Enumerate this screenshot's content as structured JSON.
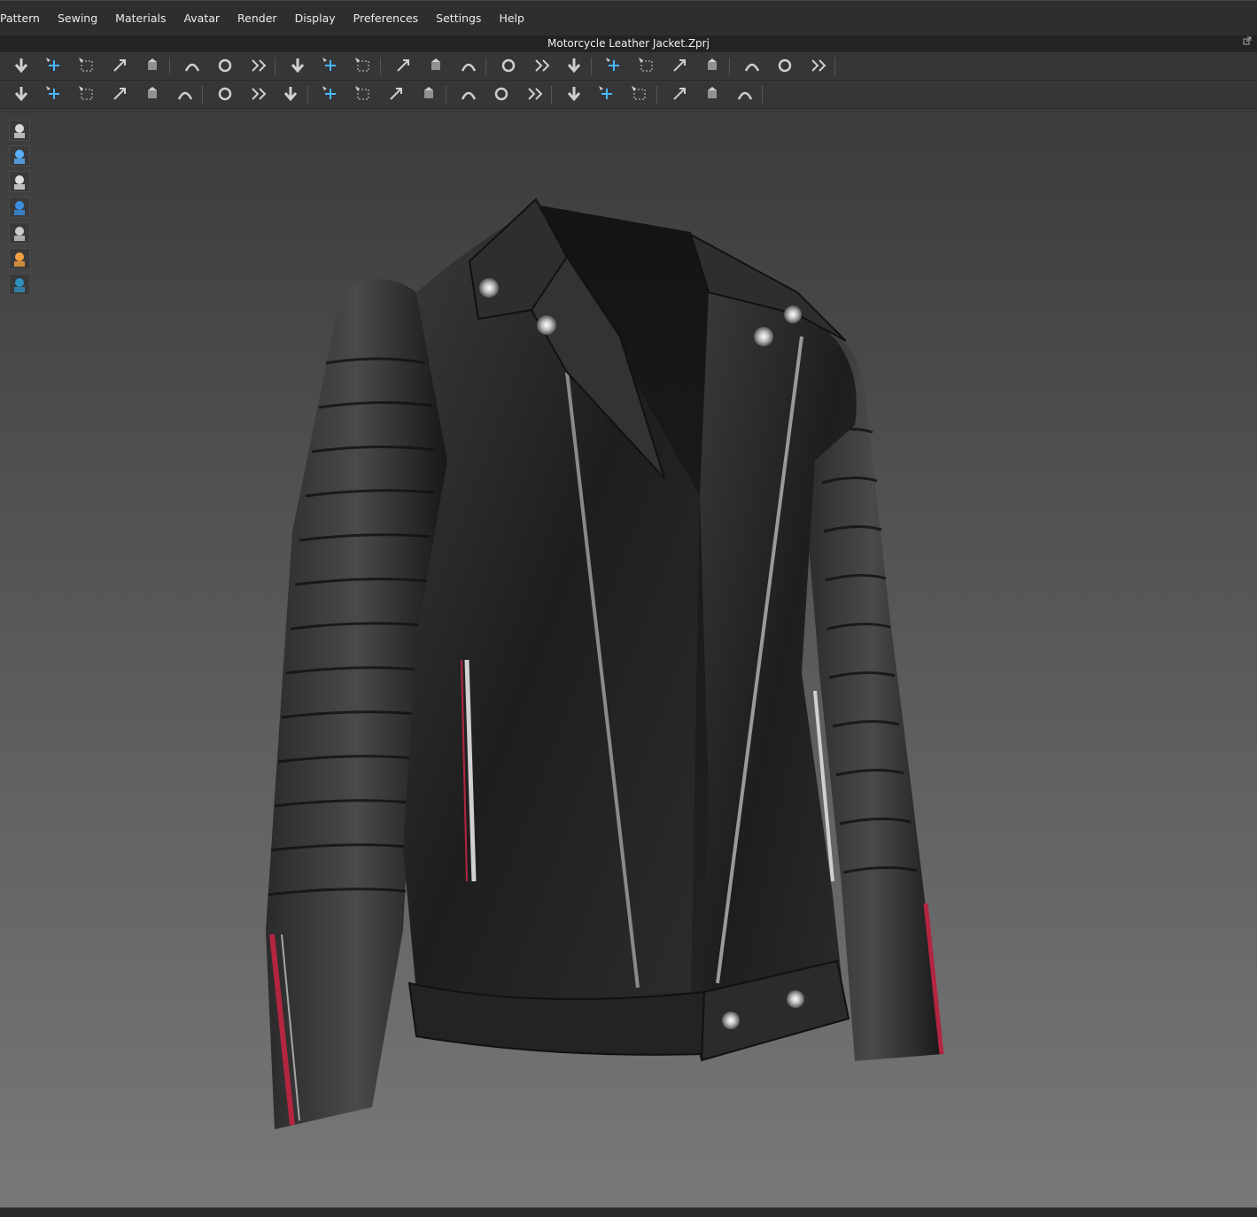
{
  "menu": {
    "items": [
      "Pattern",
      "Sewing",
      "Materials",
      "Avatar",
      "Render",
      "Display",
      "Preferences",
      "Settings",
      "Help"
    ]
  },
  "window": {
    "title": "Motorcycle Leather Jacket.Zprj"
  },
  "toolbar_1": [
    "simulation-icon",
    "transform-pattern-icon",
    "select-box-icon",
    "edit-pattern-icon",
    "transform-garment-icon",
    "fold-arrangement-icon",
    "fold-icon",
    "unfold-icon",
    "segment-sewing-icon",
    "gather-icon",
    "garment-icon",
    "arrange-front-icon",
    "arrange-side-icon",
    "avatar-icon",
    "layer-clone-up-icon",
    "layer-clone-down-icon",
    "layer-icon",
    "stack-icon",
    "stack-2-icon",
    "pin-icon",
    "pin-2-icon",
    "tape-icon",
    "measure-icon",
    "ruler-icon"
  ],
  "toolbar_2": [
    "pose-icon",
    "steam-icon",
    "iron-icon",
    "strengthen-icon",
    "shrink-icon",
    "texture-icon",
    "puckering-icon",
    "flat-sewing-icon",
    "fabric-icon",
    "button-icon",
    "buttonhole-icon",
    "line-icon",
    "snap-icon",
    "zipper-icon",
    "piping-icon",
    "piping-2-icon",
    "bond-icon",
    "bond-2-icon",
    "pleat-icon",
    "fit-map-icon",
    "stress-map-icon",
    "strain-icon"
  ],
  "side_tools": [
    "garment-display-icon",
    "avatar-display-icon",
    "avatar-silhouette-icon",
    "fabric-display-icon",
    "texture-display-icon",
    "skin-display-icon",
    "environment-icon"
  ],
  "colors": {
    "menubar_bg": "#2e2e30",
    "toolbar_bg": "#363638",
    "viewport_top": "#3b3b3c",
    "viewport_bottom": "#78787a",
    "leather": "#1c1c1c",
    "zipper_metal": "#b0b0b0",
    "red_zipper_tape": "#b32540",
    "accent_blue": "#49b7ff"
  }
}
